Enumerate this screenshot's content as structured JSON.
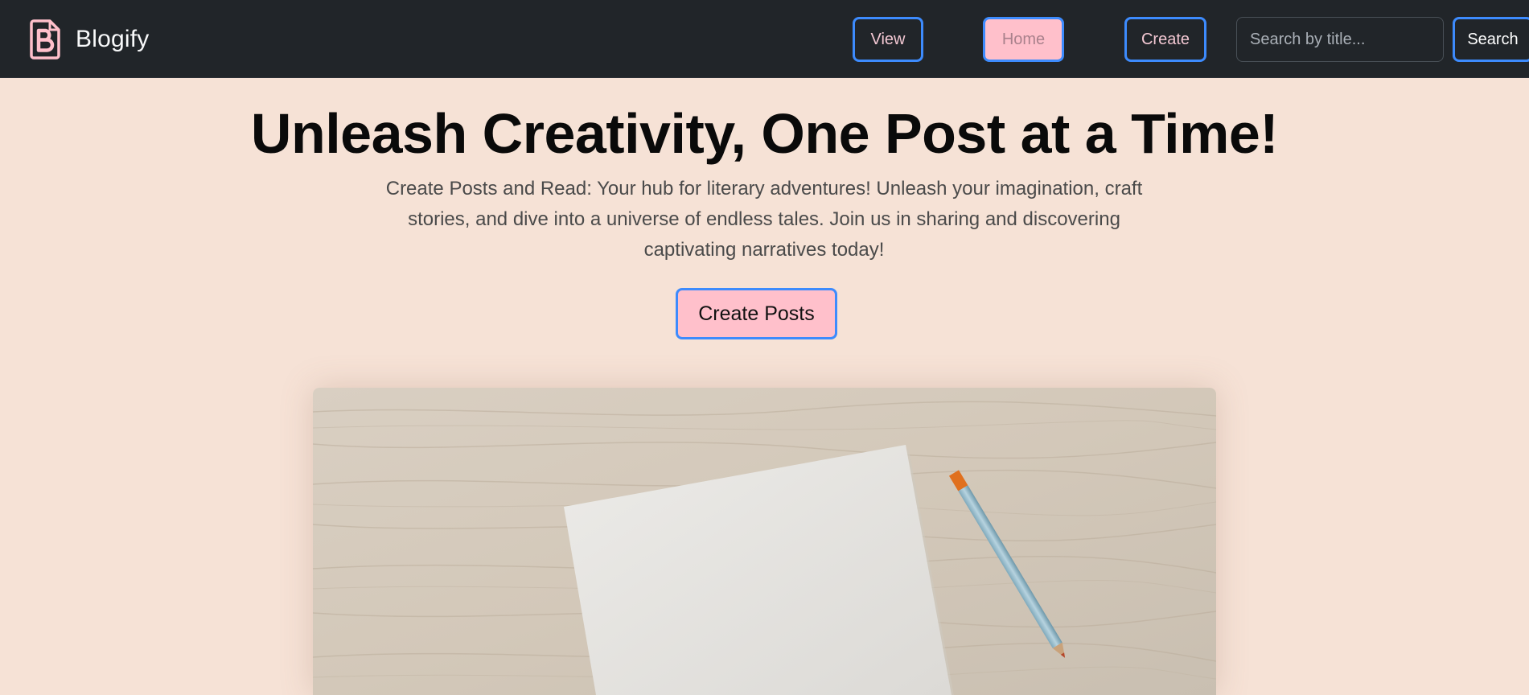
{
  "navbar": {
    "brand_name": "Blogify",
    "brand_icon": "document-b-icon",
    "links": {
      "view": "View",
      "home": "Home",
      "create": "Create"
    },
    "search": {
      "placeholder": "Search by title...",
      "value": "",
      "button_label": "Search"
    }
  },
  "hero": {
    "title": "Unleash Creativity, One Post at a Time!",
    "subtitle": "Create Posts and Read: Your hub for literary adventures! Unleash your imagination, craft stories, and dive into a universe of endless tales. Join us in sharing and discovering captivating narratives today!",
    "cta_label": "Create Posts"
  },
  "colors": {
    "page_background": "#f6e2d6",
    "navbar_background": "#212529",
    "accent_pink": "#ffc0cb",
    "focus_border_blue": "#3d8bfd"
  }
}
